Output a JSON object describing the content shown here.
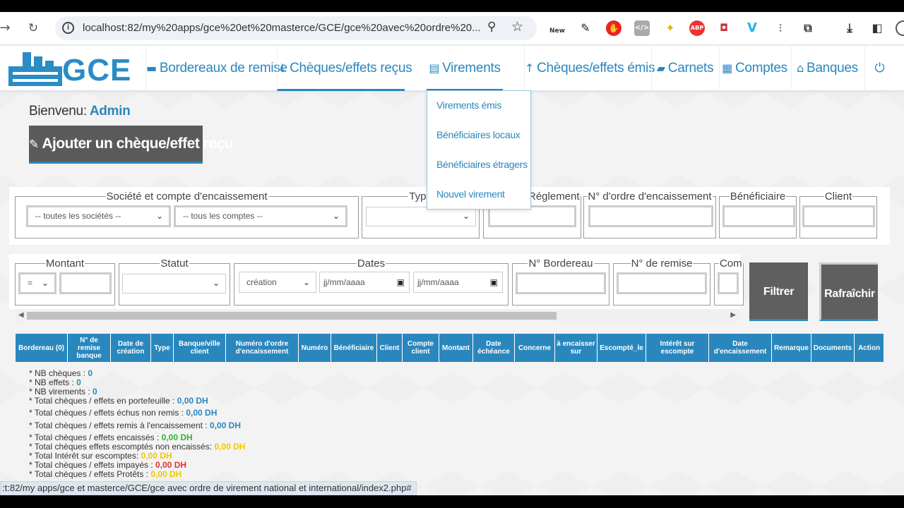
{
  "browser": {
    "url": "localhost:82/my%20apps/gce%20et%20masterce/GCE/gce%20avec%20ordre%20...",
    "extension_new_label": "New",
    "status_url": ":t:82/my apps/gce et masterce/GCE/gce avec ordre de virement national et international/index2.php#"
  },
  "app": {
    "logo_text": "GCE",
    "menu": [
      {
        "label": "Bordereaux de remise",
        "icon": "file-icon"
      },
      {
        "label": "Chèques/effets reçus",
        "icon": "arrow-down-icon"
      },
      {
        "label": "Virements",
        "icon": "file-text-icon"
      },
      {
        "label": "Chèques/effets émis",
        "icon": "arrow-up-icon"
      },
      {
        "label": "Carnets",
        "icon": "book-icon"
      },
      {
        "label": "Comptes",
        "icon": "calculator-icon"
      },
      {
        "label": "Banques",
        "icon": "bank-icon"
      }
    ],
    "dropdown": [
      "Virements émis",
      "Bénéficiaires locaux",
      "Bénéficiaires étragers",
      "Nouvel virement"
    ]
  },
  "welcome": {
    "label": "Bienvenu:",
    "user": "Admin"
  },
  "add_button": "Ajouter un chèque/effet reçu",
  "filters1": {
    "societe_legend": "Société et compte d'encaissement",
    "societe_value": "-- toutes les sociétés --",
    "compte_value": "-- tous les comptes --",
    "type_legend": "Type",
    "reglement_legend": "Réglement",
    "ordre_legend": "N° d'ordre d'encaissement",
    "beneficiaire_legend": "Bénéficiaire",
    "client_legend": "Client"
  },
  "filters2": {
    "montant_legend": "Montant",
    "montant_op": "=",
    "statut_legend": "Statut",
    "dates_legend": "Dates",
    "dates_type": "création",
    "date_placeholder": "jj/mm/aaaa",
    "bordereau_legend": "N° Bordereau",
    "remise_legend": "N° de remise",
    "com_legend": "Com"
  },
  "buttons": {
    "filter": "Filtrer",
    "refresh": "Rafraîchir"
  },
  "table_headers": [
    "Bordereau (0)",
    "N° de remise banque",
    "Date de création",
    "Type",
    "Banque/ville client",
    "Numéro d'ordre d'encaissement",
    "Numéro",
    "Bénéficiaire",
    "Client",
    "Compte client",
    "Montant",
    "Date échéance",
    "Concerne",
    "à encaisser sur",
    "Escompté_le",
    "Intérêt sur escompte",
    "Date d'encaissement",
    "Remarque",
    "Documents",
    "Action"
  ],
  "stats": [
    {
      "label": "* NB chèques : ",
      "value": "0",
      "color": "blue"
    },
    {
      "label": "* NB effets : ",
      "value": "0",
      "color": "blue"
    },
    {
      "label": "* NB virements : ",
      "value": "0",
      "color": "blue"
    },
    {
      "label": "* Total chèques / effets en portefeuille : ",
      "value": "0,00 DH",
      "color": "blue"
    },
    {
      "label": "* Total chèques / effets échus non remis : ",
      "value": "0,00 DH",
      "color": "blue"
    },
    {
      "label": "* Total chèques / effets remis à l'encaissement : ",
      "value": "0,00 DH",
      "color": "blue"
    },
    {
      "label": "* Total chèques / effets encaissés : ",
      "value": "0,00 DH",
      "color": "green"
    },
    {
      "label": "* Total chèques effets escomptés non encaissés: ",
      "value": "0,00 DH",
      "color": "yellow"
    },
    {
      "label": "* Total Intérêt sur escomptes: ",
      "value": "0,00 DH",
      "color": "yellow"
    },
    {
      "label": "* Total chèques / effets impayés : ",
      "value": "0,00 DH",
      "color": "red"
    },
    {
      "label": "* Total chèques / effets Protêts : ",
      "value": "0,00 DH",
      "color": "yellow"
    }
  ]
}
